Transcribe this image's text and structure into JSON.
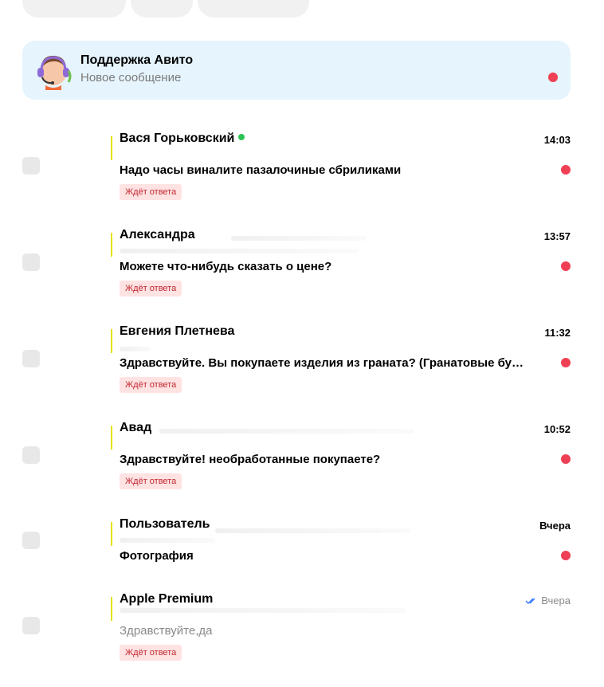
{
  "colors": {
    "accent_red": "#f04055",
    "online_green": "#2bc454",
    "support_bg": "#e5f4fd",
    "badge_bg": "#ffe3e3",
    "badge_text": "#c2262e"
  },
  "support": {
    "name": "Поддержка Авито",
    "subtitle": "Новое сообщение",
    "icon": "support-agent-icon"
  },
  "chats": [
    {
      "name": "Вася Горьковский",
      "online": true,
      "time": "14:03",
      "message": "Надо часы виналите пазалочиные сбриликами",
      "unread": true,
      "status": "Ждёт ответа"
    },
    {
      "name": "Александра",
      "online": false,
      "time": "13:57",
      "message": "Можете что-нибудь сказать о цене?",
      "unread": true,
      "status": "Ждёт ответа"
    },
    {
      "name": "Евгения Плетнева",
      "online": false,
      "time": "11:32",
      "message": "Здравствуйте. Вы покупаете изделия из граната? (Гранатовые бу…",
      "unread": true,
      "status": "Ждёт ответа"
    },
    {
      "name": "Авад",
      "online": false,
      "time": "10:52",
      "message": "Здравствуйте! необработанные покупаете?",
      "unread": true,
      "status": "Ждёт ответа"
    },
    {
      "name": "Пользователь",
      "online": false,
      "time": "Вчера",
      "message": "Фотография",
      "unread": true,
      "status": ""
    },
    {
      "name": "Apple Premium",
      "online": false,
      "time": "Вчера",
      "message": "Здравствуйте,да",
      "unread": false,
      "status": "Ждёт ответа",
      "read_icon": "double-check-icon"
    }
  ]
}
